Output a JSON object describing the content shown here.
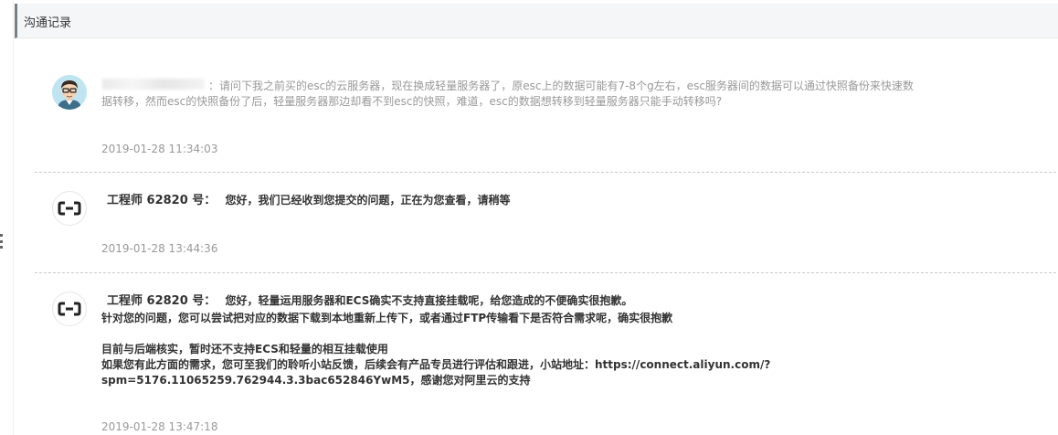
{
  "panel": {
    "title": "沟通记录"
  },
  "records": [
    {
      "role": "user",
      "separator": "：",
      "lines": [
        "请问下我之前买的esc的云服务器，现在换成轻量服务器了，原esc上的数据可能有7-8个g左右，esc服务器间的数据可以通过快照备份来快速数",
        "据转移，然而esc的快照备份了后，轻量服务器那边却看不到esc的快照，难道，esc的数据想转移到轻量服务器只能手动转移吗?"
      ],
      "time": "2019-01-28 11:34:03"
    },
    {
      "role": "engineer",
      "name": "工程师 62820 号：",
      "first_line": "您好，我们已经收到您提交的问题，正在为您查看，请稍等",
      "more_lines": [],
      "time": "2019-01-28 13:44:36"
    },
    {
      "role": "engineer",
      "name": "工程师 62820 号：",
      "first_line": "您好，轻量运用服务器和ECS确实不支持直接挂载呢，给您造成的不便确实很抱歉。",
      "more_lines": [
        "针对您的问题，您可以尝试把对应的数据下载到本地重新上传下，或者通过FTP传输看下是否符合需求呢，确实很抱歉",
        "",
        "目前与后端核实，暂时还不支持ECS和轻量的相互挂载使用",
        "如果您有此方面的需求，您可至我们的聆听小站反馈，后续会有产品专员进行评估和跟进，小站地址：https://connect.aliyun.com/?",
        "spm=5176.11065259.762944.3.3bac652846YwM5，感谢您对阿里云的支持"
      ],
      "time": "2019-01-28 13:47:18"
    }
  ],
  "icons": {
    "engineer_avatar": "aliyun-logo-icon",
    "user_avatar": "user-avatar-icon",
    "accent": "#778087"
  }
}
